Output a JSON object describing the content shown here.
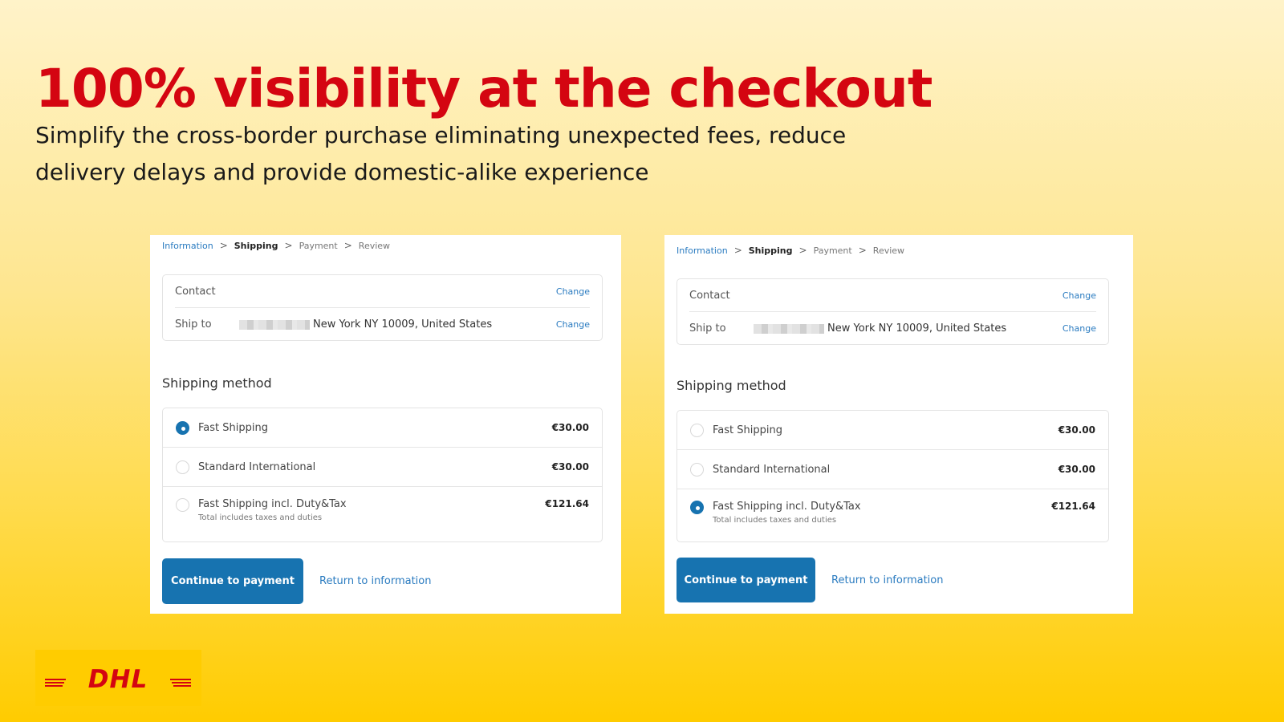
{
  "hero": {
    "title": "100% visibility at the checkout",
    "subtitle": "Simplify the cross-border purchase eliminating unexpected fees, reduce delivery delays and provide domestic-alike experience"
  },
  "colors": {
    "brand_red": "#d40511",
    "brand_yellow": "#ffcc00",
    "accent_blue": "#1773b0"
  },
  "checkouts": [
    {
      "breadcrumb": [
        "Information",
        "Shipping",
        "Payment",
        "Review"
      ],
      "breadcrumb_current": "Shipping",
      "contact": {
        "label": "Contact",
        "value": "",
        "change": "Change"
      },
      "ship_to": {
        "label": "Ship to",
        "value": "New York NY 10009, United States",
        "change": "Change"
      },
      "section_title": "Shipping method",
      "methods": [
        {
          "name": "Fast Shipping",
          "price": "€30.00",
          "selected": true
        },
        {
          "name": "Standard International",
          "price": "€30.00",
          "selected": false
        },
        {
          "name": "Fast Shipping incl. Duty&Tax",
          "sub": "Total includes taxes and duties",
          "price": "€121.64",
          "selected": false
        }
      ],
      "primary_button": "Continue to payment",
      "secondary_link": "Return to information"
    },
    {
      "breadcrumb": [
        "Information",
        "Shipping",
        "Payment",
        "Review"
      ],
      "breadcrumb_current": "Shipping",
      "contact": {
        "label": "Contact",
        "value": "",
        "change": "Change"
      },
      "ship_to": {
        "label": "Ship to",
        "value": "New York NY 10009, United States",
        "change": "Change"
      },
      "section_title": "Shipping method",
      "methods": [
        {
          "name": "Fast Shipping",
          "price": "€30.00",
          "selected": false
        },
        {
          "name": "Standard International",
          "price": "€30.00",
          "selected": false
        },
        {
          "name": "Fast Shipping incl. Duty&Tax",
          "sub": "Total includes taxes and duties",
          "price": "€121.64",
          "selected": true
        }
      ],
      "primary_button": "Continue to payment",
      "secondary_link": "Return to information"
    }
  ],
  "logo": {
    "text": "DHL",
    "icon": "dhl-logo"
  }
}
